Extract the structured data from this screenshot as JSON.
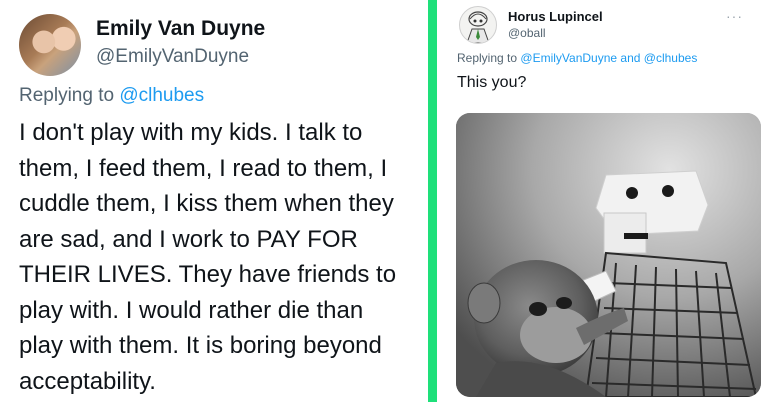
{
  "left_tweet": {
    "display_name": "Emily Van Duyne",
    "handle": "@EmilyVanDuyne",
    "replying_prefix": "Replying to",
    "replying_mention": "@clhubes",
    "body": "I don't play with my kids. I talk to\nthem, I feed them, I read to them, I\ncuddle them, I kiss them when they\nare sad, and I work to PAY FOR\nTHEIR LIVES. They have friends to\nplay with. I would rather die than\nplay with them. It is boring beyond\nacceptability."
  },
  "right_tweet": {
    "display_name": "Horus Lupincel",
    "handle": "@oball",
    "more": "···",
    "replying_prefix": "Replying to",
    "replying_mention_1": "@EmilyVanDuyne",
    "replying_and": "and",
    "replying_mention_2": "@clhubes",
    "body": "This you?"
  },
  "colors": {
    "divider": "#1ee07a",
    "mention": "#1d9bf0",
    "secondary_text": "#536471",
    "primary_text": "#0f1419"
  }
}
